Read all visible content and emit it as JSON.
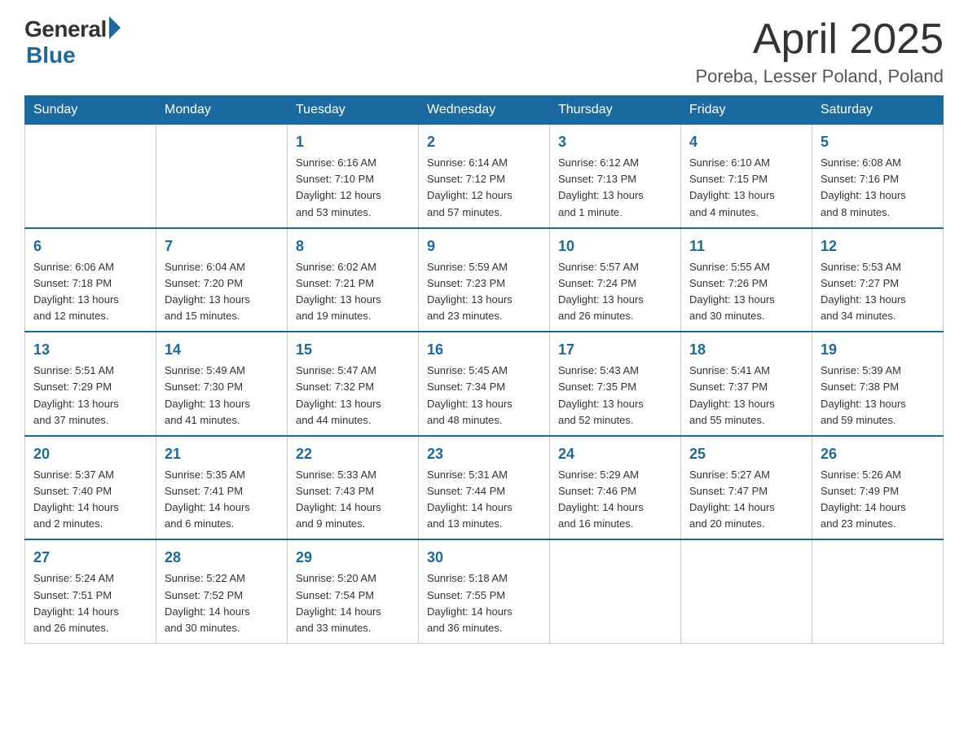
{
  "logo": {
    "general": "General",
    "blue": "Blue",
    "underline": "Blue"
  },
  "title": {
    "month_year": "April 2025",
    "location": "Poreba, Lesser Poland, Poland"
  },
  "weekdays": [
    "Sunday",
    "Monday",
    "Tuesday",
    "Wednesday",
    "Thursday",
    "Friday",
    "Saturday"
  ],
  "weeks": [
    [
      {
        "day": "",
        "info": ""
      },
      {
        "day": "",
        "info": ""
      },
      {
        "day": "1",
        "info": "Sunrise: 6:16 AM\nSunset: 7:10 PM\nDaylight: 12 hours\nand 53 minutes."
      },
      {
        "day": "2",
        "info": "Sunrise: 6:14 AM\nSunset: 7:12 PM\nDaylight: 12 hours\nand 57 minutes."
      },
      {
        "day": "3",
        "info": "Sunrise: 6:12 AM\nSunset: 7:13 PM\nDaylight: 13 hours\nand 1 minute."
      },
      {
        "day": "4",
        "info": "Sunrise: 6:10 AM\nSunset: 7:15 PM\nDaylight: 13 hours\nand 4 minutes."
      },
      {
        "day": "5",
        "info": "Sunrise: 6:08 AM\nSunset: 7:16 PM\nDaylight: 13 hours\nand 8 minutes."
      }
    ],
    [
      {
        "day": "6",
        "info": "Sunrise: 6:06 AM\nSunset: 7:18 PM\nDaylight: 13 hours\nand 12 minutes."
      },
      {
        "day": "7",
        "info": "Sunrise: 6:04 AM\nSunset: 7:20 PM\nDaylight: 13 hours\nand 15 minutes."
      },
      {
        "day": "8",
        "info": "Sunrise: 6:02 AM\nSunset: 7:21 PM\nDaylight: 13 hours\nand 19 minutes."
      },
      {
        "day": "9",
        "info": "Sunrise: 5:59 AM\nSunset: 7:23 PM\nDaylight: 13 hours\nand 23 minutes."
      },
      {
        "day": "10",
        "info": "Sunrise: 5:57 AM\nSunset: 7:24 PM\nDaylight: 13 hours\nand 26 minutes."
      },
      {
        "day": "11",
        "info": "Sunrise: 5:55 AM\nSunset: 7:26 PM\nDaylight: 13 hours\nand 30 minutes."
      },
      {
        "day": "12",
        "info": "Sunrise: 5:53 AM\nSunset: 7:27 PM\nDaylight: 13 hours\nand 34 minutes."
      }
    ],
    [
      {
        "day": "13",
        "info": "Sunrise: 5:51 AM\nSunset: 7:29 PM\nDaylight: 13 hours\nand 37 minutes."
      },
      {
        "day": "14",
        "info": "Sunrise: 5:49 AM\nSunset: 7:30 PM\nDaylight: 13 hours\nand 41 minutes."
      },
      {
        "day": "15",
        "info": "Sunrise: 5:47 AM\nSunset: 7:32 PM\nDaylight: 13 hours\nand 44 minutes."
      },
      {
        "day": "16",
        "info": "Sunrise: 5:45 AM\nSunset: 7:34 PM\nDaylight: 13 hours\nand 48 minutes."
      },
      {
        "day": "17",
        "info": "Sunrise: 5:43 AM\nSunset: 7:35 PM\nDaylight: 13 hours\nand 52 minutes."
      },
      {
        "day": "18",
        "info": "Sunrise: 5:41 AM\nSunset: 7:37 PM\nDaylight: 13 hours\nand 55 minutes."
      },
      {
        "day": "19",
        "info": "Sunrise: 5:39 AM\nSunset: 7:38 PM\nDaylight: 13 hours\nand 59 minutes."
      }
    ],
    [
      {
        "day": "20",
        "info": "Sunrise: 5:37 AM\nSunset: 7:40 PM\nDaylight: 14 hours\nand 2 minutes."
      },
      {
        "day": "21",
        "info": "Sunrise: 5:35 AM\nSunset: 7:41 PM\nDaylight: 14 hours\nand 6 minutes."
      },
      {
        "day": "22",
        "info": "Sunrise: 5:33 AM\nSunset: 7:43 PM\nDaylight: 14 hours\nand 9 minutes."
      },
      {
        "day": "23",
        "info": "Sunrise: 5:31 AM\nSunset: 7:44 PM\nDaylight: 14 hours\nand 13 minutes."
      },
      {
        "day": "24",
        "info": "Sunrise: 5:29 AM\nSunset: 7:46 PM\nDaylight: 14 hours\nand 16 minutes."
      },
      {
        "day": "25",
        "info": "Sunrise: 5:27 AM\nSunset: 7:47 PM\nDaylight: 14 hours\nand 20 minutes."
      },
      {
        "day": "26",
        "info": "Sunrise: 5:26 AM\nSunset: 7:49 PM\nDaylight: 14 hours\nand 23 minutes."
      }
    ],
    [
      {
        "day": "27",
        "info": "Sunrise: 5:24 AM\nSunset: 7:51 PM\nDaylight: 14 hours\nand 26 minutes."
      },
      {
        "day": "28",
        "info": "Sunrise: 5:22 AM\nSunset: 7:52 PM\nDaylight: 14 hours\nand 30 minutes."
      },
      {
        "day": "29",
        "info": "Sunrise: 5:20 AM\nSunset: 7:54 PM\nDaylight: 14 hours\nand 33 minutes."
      },
      {
        "day": "30",
        "info": "Sunrise: 5:18 AM\nSunset: 7:55 PM\nDaylight: 14 hours\nand 36 minutes."
      },
      {
        "day": "",
        "info": ""
      },
      {
        "day": "",
        "info": ""
      },
      {
        "day": "",
        "info": ""
      }
    ]
  ]
}
